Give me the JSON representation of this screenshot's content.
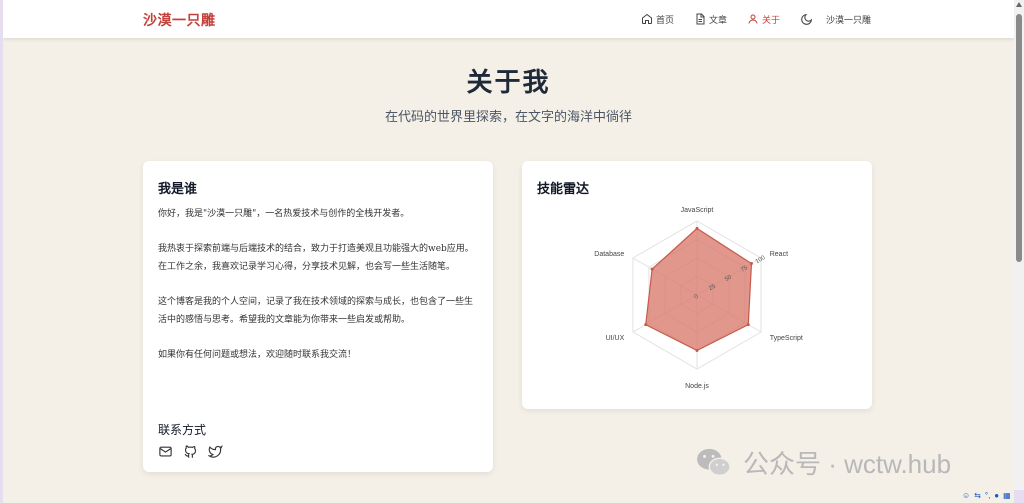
{
  "brand": "沙漠一只雕",
  "nav": {
    "home": "首页",
    "articles": "文章",
    "about": "关于",
    "user": "沙漠一只雕"
  },
  "hero": {
    "title": "关于我",
    "subtitle": "在代码的世界里探索，在文字的海洋中徜徉"
  },
  "about": {
    "title": "我是谁",
    "paragraphs": [
      "你好，我是\"沙漠一只雕\"，一名热爱技术与创作的全栈开发者。",
      "我热衷于探索前端与后端技术的结合，致力于打造美观且功能强大的web应用。在工作之余，我喜欢记录学习心得，分享技术见解，也会写一些生活随笔。",
      "这个博客是我的个人空间，记录了我在技术领域的探索与成长，也包含了一些生活中的感悟与思考。希望我的文章能为你带来一些启发或帮助。",
      "如果你有任何问题或想法，欢迎随时联系我交流！"
    ],
    "contact_title": "联系方式"
  },
  "skills": {
    "title": "技能雷达"
  },
  "chart_data": {
    "type": "radar",
    "axes": [
      "JavaScript",
      "React",
      "TypeScript",
      "Node.js",
      "UI/UX",
      "Database"
    ],
    "values": [
      90,
      85,
      80,
      75,
      80,
      70
    ],
    "range": [
      0,
      100
    ],
    "tick_labels": [
      "0",
      "25",
      "50",
      "75",
      "100"
    ],
    "fill_color": "#d97a6c",
    "stroke_color": "#c65a4b"
  },
  "watermark": "公众号 · wctw.hub",
  "colors": {
    "accent": "#c2413a",
    "background": "#f4f0e8"
  }
}
